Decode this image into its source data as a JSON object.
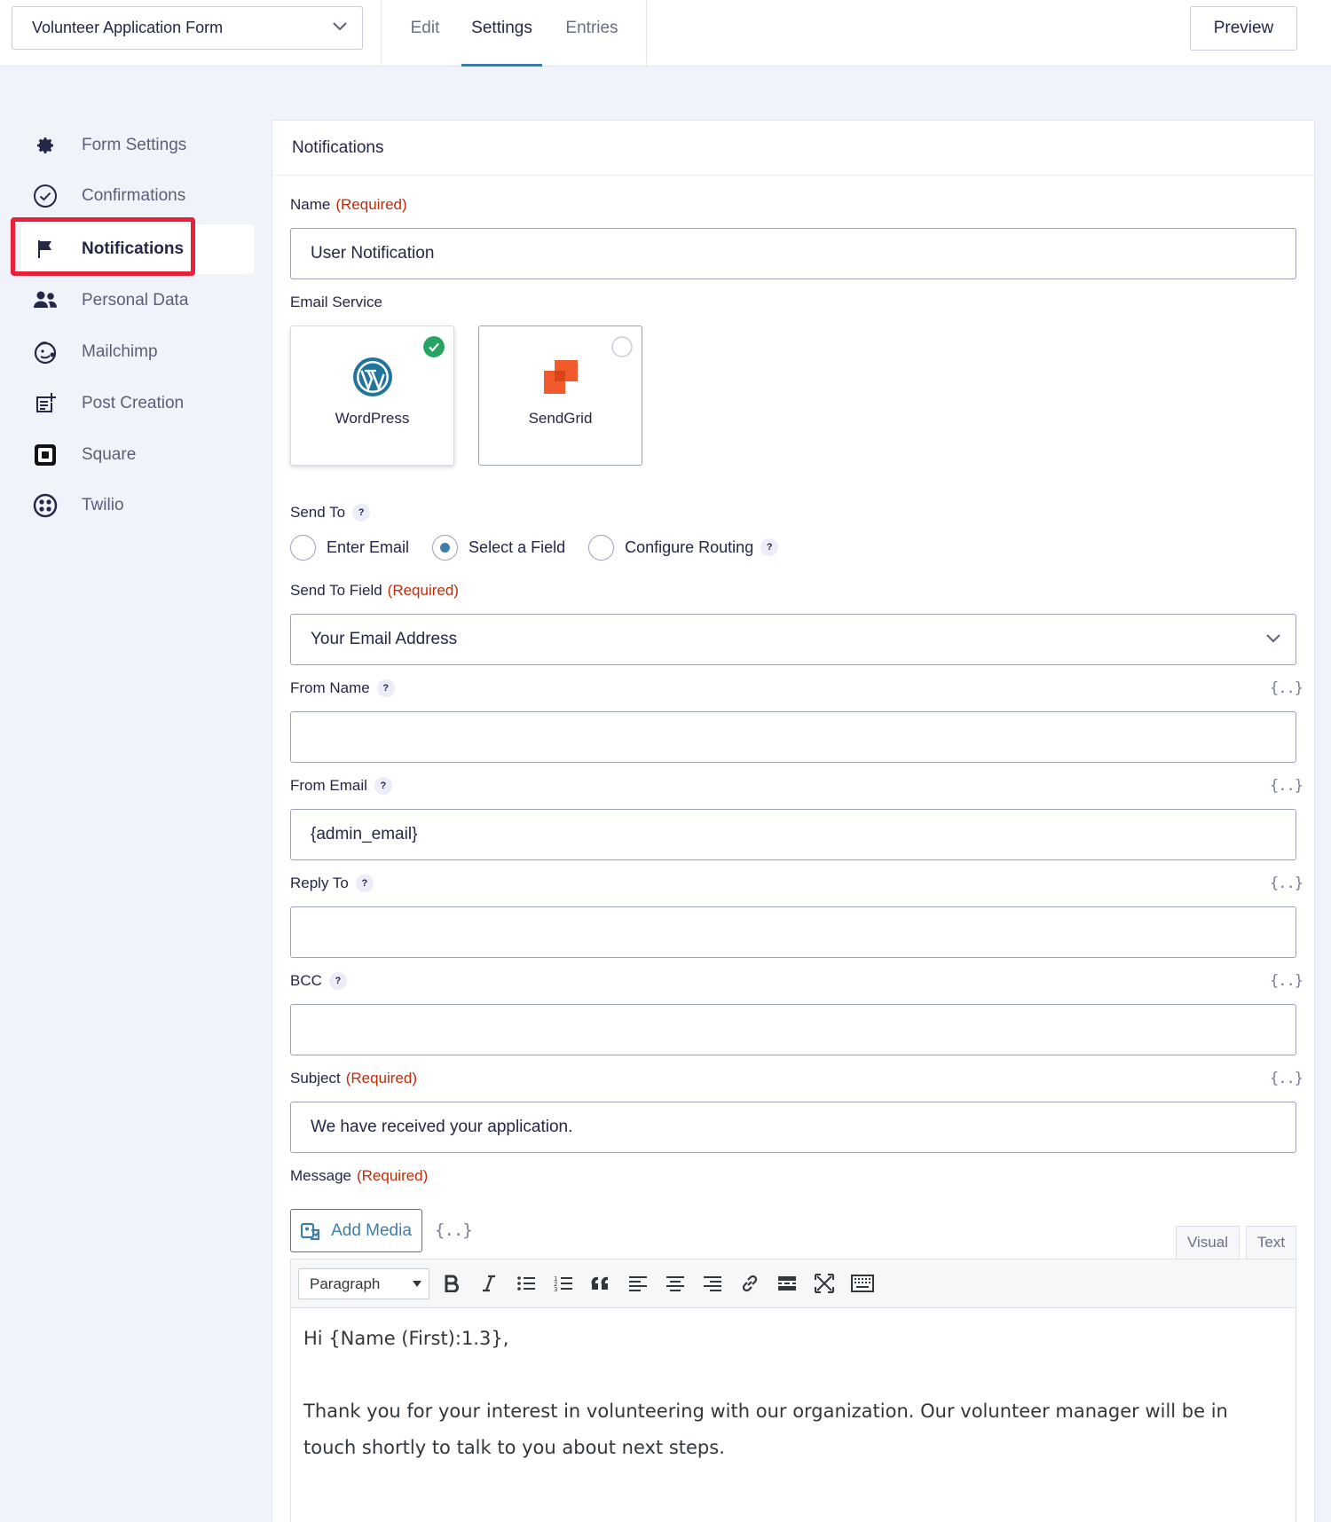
{
  "header": {
    "form_selector": "Volunteer Application Form",
    "tabs": [
      {
        "label": "Edit",
        "active": false
      },
      {
        "label": "Settings",
        "active": true
      },
      {
        "label": "Entries",
        "active": false
      }
    ],
    "preview_label": "Preview"
  },
  "sidebar": {
    "items": [
      {
        "label": "Form Settings",
        "icon": "gear-icon"
      },
      {
        "label": "Confirmations",
        "icon": "check-circle-icon"
      },
      {
        "label": "Notifications",
        "icon": "flag-icon",
        "active": true
      },
      {
        "label": "Personal Data",
        "icon": "users-icon"
      },
      {
        "label": "Mailchimp",
        "icon": "mailchimp-icon"
      },
      {
        "label": "Post Creation",
        "icon": "post-add-icon"
      },
      {
        "label": "Square",
        "icon": "square-icon"
      },
      {
        "label": "Twilio",
        "icon": "twilio-icon"
      }
    ]
  },
  "panel": {
    "title": "Notifications",
    "required_text": "(Required)",
    "name": {
      "label": "Name",
      "value": "User Notification"
    },
    "email_service": {
      "label": "Email Service",
      "options": [
        {
          "label": "WordPress",
          "selected": true
        },
        {
          "label": "SendGrid",
          "selected": false
        }
      ]
    },
    "send_to": {
      "label": "Send To",
      "options": [
        {
          "label": "Enter Email",
          "selected": false
        },
        {
          "label": "Select a Field",
          "selected": true
        },
        {
          "label": "Configure Routing",
          "selected": false
        }
      ]
    },
    "send_to_field": {
      "label": "Send To Field",
      "value": "Your Email Address"
    },
    "from_name": {
      "label": "From Name",
      "value": ""
    },
    "from_email": {
      "label": "From Email",
      "value": "{admin_email}"
    },
    "reply_to": {
      "label": "Reply To",
      "value": ""
    },
    "bcc": {
      "label": "BCC",
      "value": ""
    },
    "subject": {
      "label": "Subject",
      "value": "We have received your application."
    },
    "message": {
      "label": "Message",
      "add_media_label": "Add Media",
      "tab_visual": "Visual",
      "tab_text": "Text",
      "format_select": "Paragraph",
      "body_line1": "Hi {Name (First):1.3},",
      "body_line2": "Thank you for your interest in volunteering with our organization. Our volunteer manager will be in touch shortly to talk to you about next steps."
    },
    "help_glyph": "?",
    "merge_tag_glyph": "{..}"
  },
  "colors": {
    "accent": "#3e7da6",
    "required": "#c02b0a",
    "highlight": "#e8213b",
    "check_green": "#25a362",
    "sendgrid": "#f15a2b",
    "wordpress": "#21759b"
  }
}
